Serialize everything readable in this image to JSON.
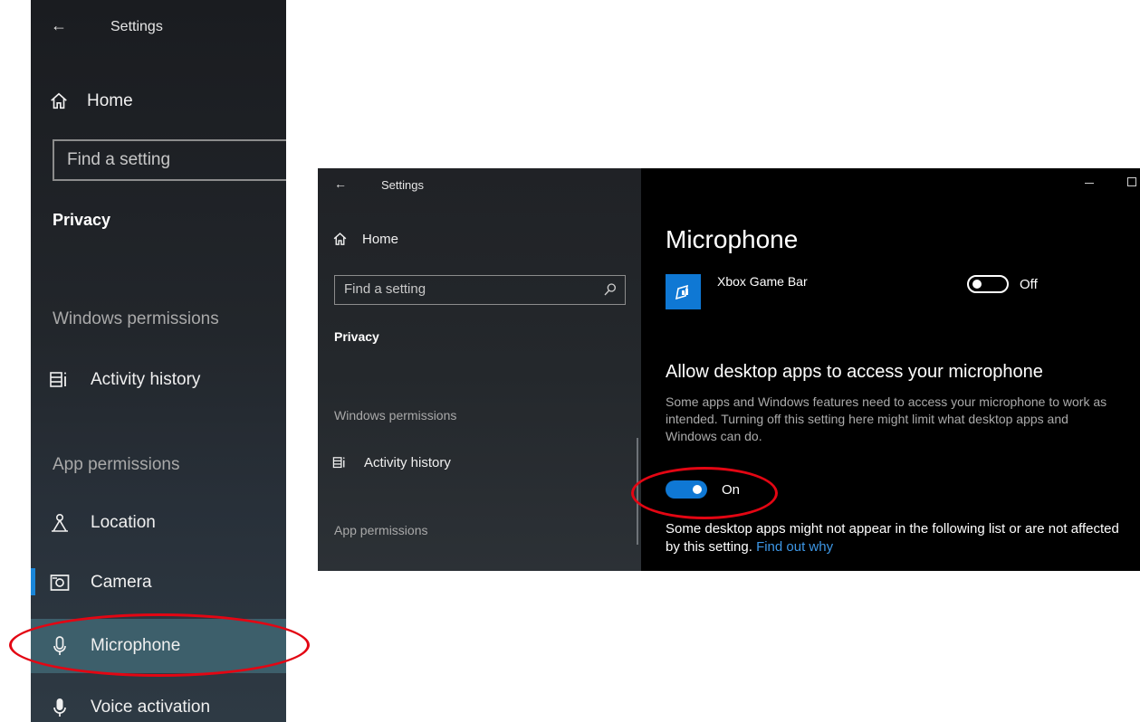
{
  "left_window": {
    "title": "Settings",
    "home_label": "Home",
    "search_placeholder": "Find a setting",
    "category": "Privacy",
    "windows_permissions_header": "Windows permissions",
    "activity_history_label": "Activity history",
    "app_permissions_header": "App permissions",
    "items": [
      {
        "label": "Location",
        "icon": "location-icon"
      },
      {
        "label": "Camera",
        "icon": "camera-icon",
        "selected": true
      },
      {
        "label": "Microphone",
        "icon": "microphone-icon",
        "highlighted": true
      },
      {
        "label": "Voice activation",
        "icon": "voice-activation-icon"
      }
    ]
  },
  "right_window": {
    "title": "Settings",
    "home_label": "Home",
    "search_placeholder": "Find a setting",
    "category": "Privacy",
    "windows_permissions_header": "Windows permissions",
    "activity_history_label": "Activity history",
    "app_permissions_header": "App permissions",
    "page_title": "Microphone",
    "app_row": {
      "name": "Xbox Game Bar",
      "toggle_label": "Off",
      "toggle_state": "off"
    },
    "desktop_section": {
      "heading": "Allow desktop apps to access your microphone",
      "description": "Some apps and Windows features need to access your microphone to work as intended. Turning off this setting here might limit what desktop apps and Windows can do.",
      "toggle_label": "On",
      "toggle_state": "on",
      "note": "Some desktop apps might not appear in the following list or are not affected by this setting.",
      "link": "Find out why"
    }
  },
  "colors": {
    "accent": "#0f78d4",
    "highlight_ellipse": "#e30613",
    "link": "#3d97e6"
  }
}
